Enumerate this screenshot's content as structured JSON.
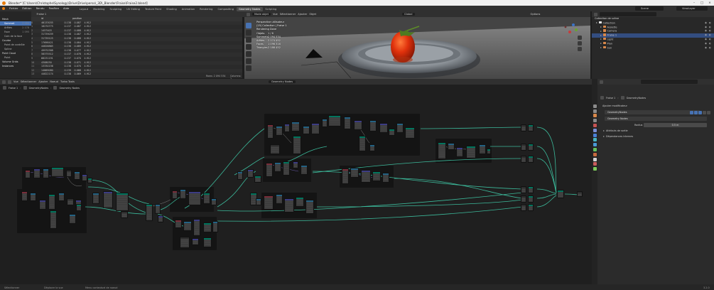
{
  "window": {
    "title": "Blender* [C:\\Users\\Christophe\\Synology\\Drive\\Drive\\perso\\_3D\\_Blender\\Fraise\\Fraise2.blend]"
  },
  "menu": [
    "Fichier",
    "Édition",
    "Rendu",
    "Fenêtre",
    "Aide"
  ],
  "workspaces": [
    "Layout",
    "Modeling",
    "Sculpting",
    "UV Editing",
    "Texture Paint",
    "Shading",
    "Animation",
    "Rendering",
    "Compositing",
    "Geometry Nodes",
    "Scripting"
  ],
  "active_workspace": "Geometry Nodes",
  "scene": {
    "name": "Scene",
    "view_layer": "ViewLayer"
  },
  "spreadsheet": {
    "header": {
      "mode": "Evaluated",
      "object": "Fraise 1"
    },
    "sidebar": [
      {
        "label": "Mesh",
        "count": ""
      },
      {
        "label": "Sommet",
        "count": "2 094"
      },
      {
        "label": "Arêtes",
        "count": "2 178"
      },
      {
        "label": "Face",
        "count": "1 095"
      },
      {
        "label": "Coin de la face",
        "count": ""
      },
      {
        "label": "Courbe",
        "count": ""
      },
      {
        "label": "Point de contrôle",
        "count": ""
      },
      {
        "label": "Spline",
        "count": ""
      },
      {
        "label": "Point Cloud",
        "count": ""
      },
      {
        "label": "Point",
        "count": ""
      },
      {
        "label": "Volume Grids",
        "count": ""
      },
      {
        "label": "Instances",
        "count": ""
      }
    ],
    "columns": [
      "",
      "id",
      "",
      "position",
      ""
    ],
    "rows": [
      [
        "0",
        "46133035",
        "0.138",
        "0.087",
        "4.912"
      ],
      [
        "1",
        "18270775",
        "0.137",
        "0.087",
        "4.912"
      ],
      [
        "2",
        "1457403",
        "0.137",
        "0.088",
        "4.912"
      ],
      [
        "3",
        "31739039",
        "0.138",
        "0.087",
        "4.912"
      ],
      [
        "4",
        "31739125",
        "0.138",
        "0.088",
        "4.912"
      ],
      [
        "5",
        "17698421",
        "0.138",
        "0.084",
        "4.912"
      ],
      [
        "6",
        "44826865",
        "0.138",
        "0.089",
        "4.912"
      ],
      [
        "7",
        "49970388",
        "0.138",
        "0.077",
        "4.912"
      ],
      [
        "8",
        "58375512",
        "0.137",
        "0.078",
        "4.912"
      ],
      [
        "9",
        "68231191",
        "0.137",
        "0.070",
        "4.912"
      ],
      [
        "10",
        "4308030",
        "0.138",
        "0.071",
        "4.912"
      ],
      [
        "11",
        "13330156",
        "0.138",
        "0.070",
        "4.912"
      ],
      [
        "12",
        "14669080",
        "0.139",
        "0.068",
        "4.912"
      ],
      [
        "13",
        "44822174",
        "0.138",
        "0.069",
        "4.912"
      ]
    ],
    "footer": {
      "rows": "Rows: 2 094 534",
      "columns": "Columns: 2"
    }
  },
  "viewport": {
    "menu": [
      "Mode objet",
      "Vue",
      "Sélectionner",
      "Ajouter",
      "Objet"
    ],
    "orientation": "Global",
    "options_label": "Options",
    "overlay": {
      "line1": "Perspective utilisateur",
      "line2": "(25) Collection | Fraise 1",
      "line3": "Rendering Done",
      "stats": [
        {
          "label": "Objets",
          "value": "1 / 6"
        },
        {
          "label": "Sommets",
          "value": "2 094 534"
        },
        {
          "label": "Arêtes",
          "value": "2 174 452"
        },
        {
          "label": "Faces",
          "value": "1 096 316"
        },
        {
          "label": "Triangles",
          "value": "2 188 452"
        }
      ]
    }
  },
  "outliner": {
    "title": "Collection de scène",
    "items": [
      {
        "label": "Collection",
        "depth": 0,
        "selected": false
      },
      {
        "label": "Assiette",
        "depth": 1,
        "selected": false
      },
      {
        "label": "Camera",
        "depth": 1,
        "selected": false
      },
      {
        "label": "Fraise 1",
        "depth": 1,
        "selected": true
      },
      {
        "label": "Light",
        "depth": 1,
        "selected": false
      },
      {
        "label": "Plan",
        "depth": 1,
        "selected": false
      },
      {
        "label": "Sun",
        "depth": 1,
        "selected": false
      }
    ]
  },
  "node_editor": {
    "menu": [
      "Vue",
      "Sélectionner",
      "Ajouter",
      "Noeud",
      "Turbo Tools"
    ],
    "node_tree": "Geometry Nodes",
    "breadcrumb": [
      "Fraise 1",
      "GeometryNodes",
      "Geometry Nodes"
    ]
  },
  "properties": {
    "breadcrumb": [
      "Fraise 1",
      "GeometryNodes"
    ],
    "add_modifier": "Ajouter modificateur",
    "modifier_name": "GeometryNodes",
    "node_group": "Geometry Nodes",
    "field_label": "Radius",
    "field_value": "0.5 m",
    "sections": [
      "Attributs de sortie",
      "Dépendances internes"
    ],
    "icon_colors": [
      "#8b8b8b",
      "#8b8b8b",
      "#d7874a",
      "#8b8b8b",
      "#c55353",
      "#7a8fd6",
      "#4b80d6",
      "#49b5c4",
      "#4a9ad6",
      "#64c15e",
      "#c66a3e",
      "#d4d4d4",
      "#c85b5b",
      "#7dca5b"
    ]
  },
  "statusbar": {
    "select": "Sélectionner",
    "pan": "Déplacer la vue",
    "context": "Menu contextuel de noeud",
    "version": "3.2.0"
  },
  "colors": {
    "accent": "#4772b3",
    "wire": "#3fcaa8",
    "geo_header": "#00755d"
  }
}
